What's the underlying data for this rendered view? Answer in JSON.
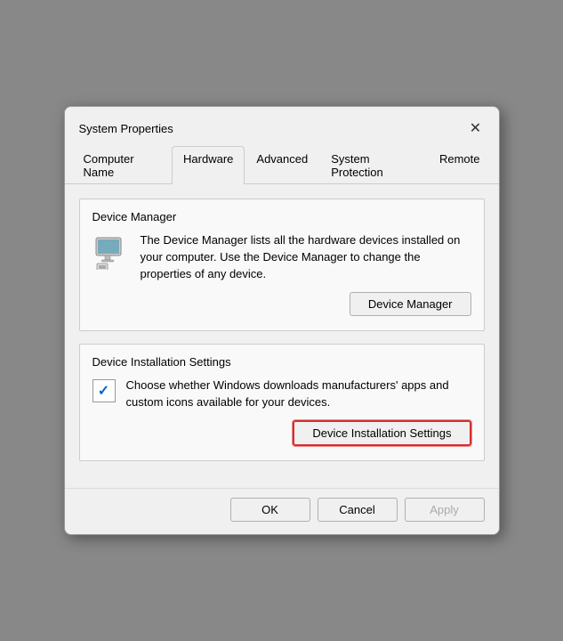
{
  "dialog": {
    "title": "System Properties",
    "close_label": "✕"
  },
  "tabs": [
    {
      "label": "Computer Name",
      "active": false
    },
    {
      "label": "Hardware",
      "active": true
    },
    {
      "label": "Advanced",
      "active": false
    },
    {
      "label": "System Protection",
      "active": false
    },
    {
      "label": "Remote",
      "active": false
    }
  ],
  "device_manager_section": {
    "title": "Device Manager",
    "description": "The Device Manager lists all the hardware devices installed on your computer. Use the Device Manager to change the properties of any device.",
    "button_label": "Device Manager"
  },
  "device_installation_section": {
    "title": "Device Installation Settings",
    "description": "Choose whether Windows downloads manufacturers' apps and custom icons available for your devices.",
    "button_label": "Device Installation Settings"
  },
  "footer": {
    "ok_label": "OK",
    "cancel_label": "Cancel",
    "apply_label": "Apply"
  }
}
